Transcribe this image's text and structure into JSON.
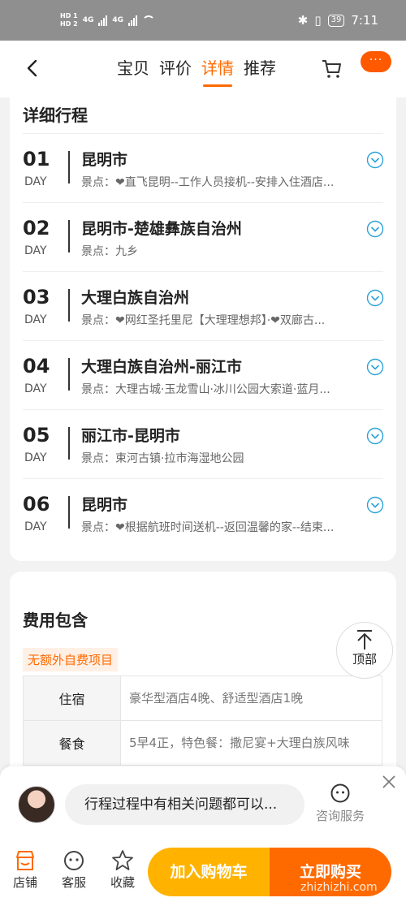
{
  "status": {
    "hd1": "HD 1",
    "hd2": "HD 2",
    "net1": "4G",
    "net2": "4G",
    "battery": "39",
    "time": "7:11"
  },
  "header": {
    "tabs": [
      "宝贝",
      "评价",
      "详情",
      "推荐"
    ],
    "active_tab": "详情",
    "more_label": "···",
    "accent": "#ff6a00"
  },
  "itinerary": {
    "title": "详细行程",
    "days": [
      {
        "num": "01",
        "word": "DAY",
        "city": "昆明市",
        "spots": "景点：❤直飞昆明--工作人员接机--安排入住酒店..."
      },
      {
        "num": "02",
        "word": "DAY",
        "city": "昆明市-楚雄彝族自治州",
        "spots": "景点：九乡"
      },
      {
        "num": "03",
        "word": "DAY",
        "city": "大理白族自治州",
        "spots": "景点：❤网红圣托里尼【大理理想邦】·❤双廊古..."
      },
      {
        "num": "04",
        "word": "DAY",
        "city": "大理白族自治州-丽江市",
        "spots": "景点：大理古城·玉龙雪山·冰川公园大索道·蓝月..."
      },
      {
        "num": "05",
        "word": "DAY",
        "city": "丽江市-昆明市",
        "spots": "景点：束河古镇·拉市海湿地公园"
      },
      {
        "num": "06",
        "word": "DAY",
        "city": "昆明市",
        "spots": "景点：❤根据航班时间送机--返回温馨的家--结束..."
      }
    ]
  },
  "cost": {
    "title": "费用包含",
    "badge": "无额外自费项目",
    "rows": [
      {
        "key": "住宿",
        "value": "豪华型酒店4晚、舒适型酒店1晚"
      },
      {
        "key": "餐食",
        "value": "5早4正，特色餐：撒尼宴+大理白族风味"
      }
    ]
  },
  "top_button": "顶部",
  "chat": {
    "message": "行程过程中有相关问题都可以...",
    "consult_label": "咨询服务"
  },
  "bottom_nav": {
    "shop": "店铺",
    "service": "客服",
    "favorite": "收藏",
    "add_cart": "加入购物车",
    "buy_now": "立即购买",
    "cart_color": "#ffb300",
    "buy_color": "#ff6a00"
  },
  "watermark": "zhizhizhi.com"
}
